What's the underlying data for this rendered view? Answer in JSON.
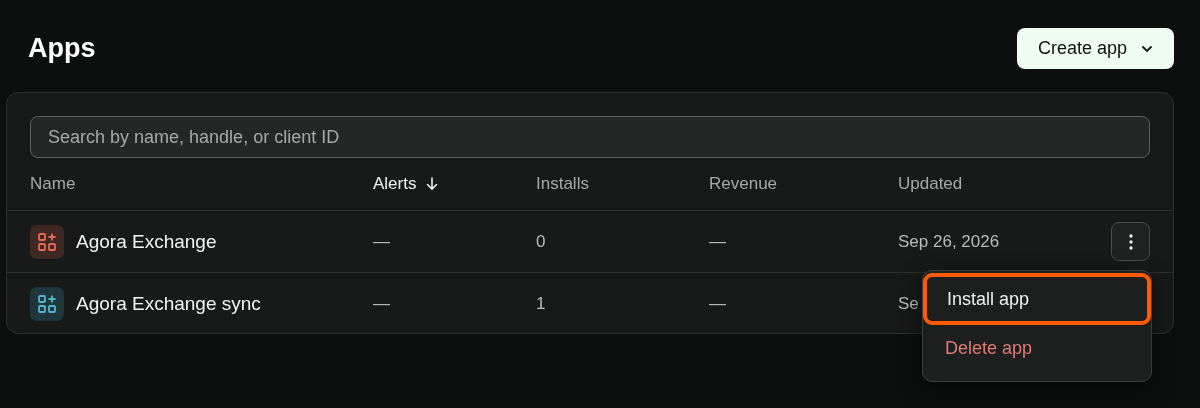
{
  "page": {
    "title": "Apps"
  },
  "create_button": {
    "label": "Create app"
  },
  "search": {
    "placeholder": "Search by name, handle, or client ID"
  },
  "table": {
    "columns": [
      {
        "label": "Name",
        "sorted": false
      },
      {
        "label": "Alerts",
        "sorted": true
      },
      {
        "label": "Installs",
        "sorted": false
      },
      {
        "label": "Revenue",
        "sorted": false
      },
      {
        "label": "Updated",
        "sorted": false
      }
    ],
    "rows": [
      {
        "name": "Agora Exchange",
        "color": "#e8685a",
        "alerts": "—",
        "installs": "0",
        "revenue": "—",
        "updated": "Sep 26, 2026",
        "menu_button": true
      },
      {
        "name": "Agora Exchange sync",
        "color": "#4fb8d0",
        "alerts": "—",
        "installs": "1",
        "revenue": "—",
        "updated": "Se"
      }
    ]
  },
  "menu": {
    "items": [
      {
        "label": "Install app",
        "kind": "normal",
        "selected": true
      },
      {
        "label": "Delete app",
        "kind": "danger",
        "selected": false
      }
    ]
  }
}
